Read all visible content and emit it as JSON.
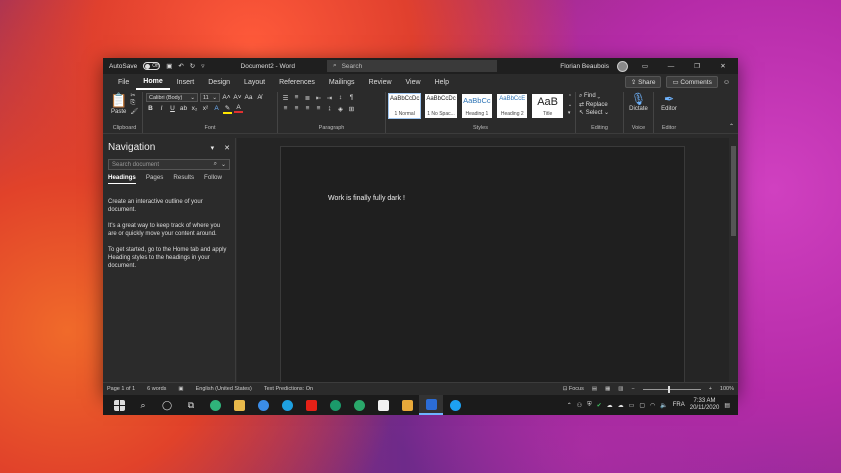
{
  "titlebar": {
    "autosave_label": "AutoSave",
    "autosave_state": "Off",
    "doc_title": "Document2  -  Word",
    "search_placeholder": "Search",
    "user_name": "Florian Beaubois"
  },
  "menu": {
    "tabs": [
      "File",
      "Home",
      "Insert",
      "Design",
      "Layout",
      "References",
      "Mailings",
      "Review",
      "View",
      "Help"
    ],
    "active_tab": "Home",
    "share_label": "Share",
    "comments_label": "Comments"
  },
  "ribbon": {
    "paste_label": "Paste",
    "font_name": "Calibri (Body)",
    "font_size": "11",
    "styles": [
      {
        "sample": "AaBbCcDc",
        "name": "1 Normal"
      },
      {
        "sample": "AaBbCcDc",
        "name": "1 No Spac..."
      },
      {
        "sample": "AaBbCc",
        "name": "Heading 1"
      },
      {
        "sample": "AaBbCcE",
        "name": "Heading 2"
      },
      {
        "sample": "AaB",
        "name": "Title"
      }
    ],
    "find_label": "Find",
    "replace_label": "Replace",
    "select_label": "Select",
    "dictate_label": "Dictate",
    "editor_label": "Editor",
    "group_labels": {
      "clipboard": "Clipboard",
      "font": "Font",
      "paragraph": "Paragraph",
      "styles": "Styles",
      "editing": "Editing",
      "voice": "Voice",
      "editor": "Editor"
    }
  },
  "navigation": {
    "title": "Navigation",
    "search_placeholder": "Search document",
    "tabs": [
      "Headings",
      "Pages",
      "Results",
      "Follow"
    ],
    "active_tab": "Headings",
    "paragraphs": [
      "Create an interactive outline of your document.",
      "It's a great way to keep track of where you are or quickly move your content around.",
      "To get started, go to the Home tab and apply Heading styles to the headings in your document."
    ]
  },
  "document": {
    "text": "Work is finally fully dark !"
  },
  "status": {
    "page": "Page 1 of 1",
    "words": "6 words",
    "language": "English (United States)",
    "predictions": "Text Predictions: On",
    "focus": "Focus",
    "zoom": "100%",
    "zoom_fraction": 0.45
  },
  "taskbar": {
    "language": "FRA",
    "time": "7:33 AM",
    "date": "20/11/2020"
  },
  "colors": {
    "accent": "#6fb4ff",
    "window_bg": "#2b2b2b",
    "page_bg": "#1f1f1f"
  }
}
